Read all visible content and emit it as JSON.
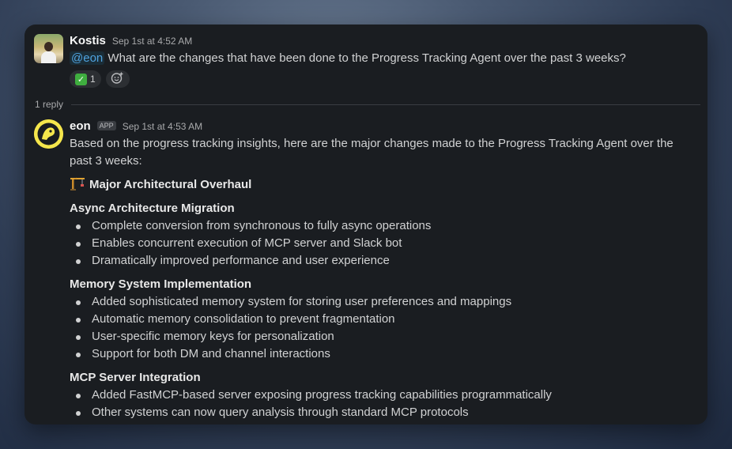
{
  "thread": {
    "parent": {
      "author": "Kostis",
      "time": "Sep 1st at 4:52 AM",
      "mention": "@eon",
      "text": " What are the changes that have been done to the Progress Tracking Agent over the past 3 weeks?",
      "reactions": [
        {
          "emoji": "check-mark-icon",
          "count": "1"
        }
      ]
    },
    "reply_count": "1 reply",
    "reply": {
      "author": "eon",
      "badge": "APP",
      "time": "Sep 1st at 4:53 AM",
      "intro": "Based on the progress tracking insights, here are the major changes made to the Progress Tracking Agent over the past 3 weeks:",
      "heading": "Major Architectural Overhaul",
      "sections": [
        {
          "title": "Async Architecture Migration",
          "items": [
            "Complete conversion from synchronous to fully async operations",
            "Enables concurrent execution of MCP server and Slack bot",
            "Dramatically improved performance and user experience"
          ]
        },
        {
          "title": "Memory System Implementation",
          "items": [
            "Added sophisticated memory system for storing user preferences and mappings",
            "Automatic memory consolidation to prevent fragmentation",
            "User-specific memory keys for personalization",
            "Support for both DM and channel interactions"
          ]
        },
        {
          "title": "MCP Server Integration",
          "items": [
            "Added FastMCP-based server exposing progress tracking capabilities programmatically",
            "Other systems can now query analysis through standard MCP protocols"
          ]
        }
      ]
    }
  },
  "colors": {
    "window_bg": "#1a1d21",
    "mention": "#4fa3e0",
    "eon_avatar": "#f5e64c"
  }
}
